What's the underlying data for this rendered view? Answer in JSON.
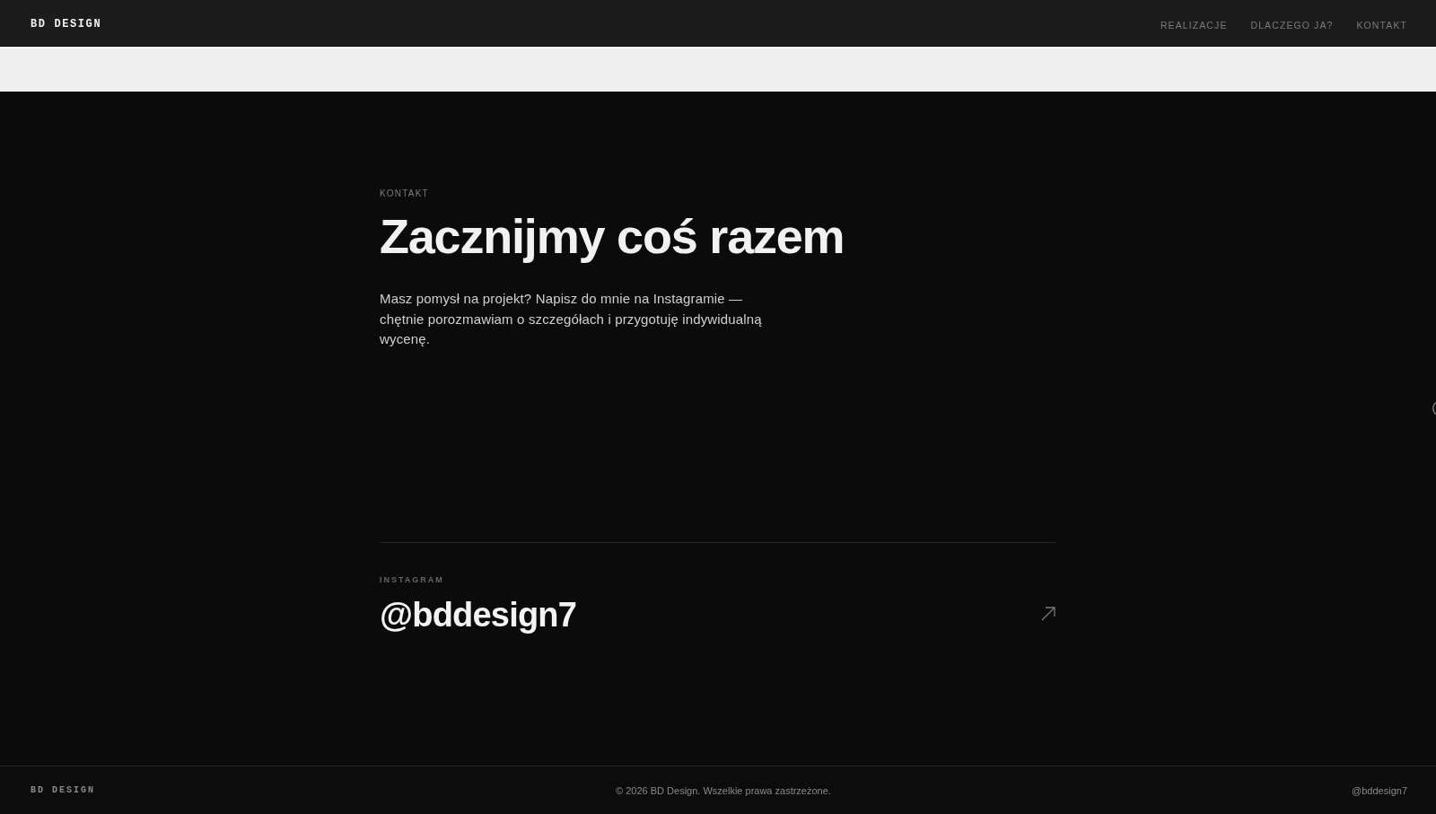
{
  "header": {
    "logo": "BD DESIGN",
    "nav": [
      "REALIZACJE",
      "DLACZEGO JA?",
      "KONTAKT"
    ]
  },
  "contact": {
    "eyebrow": "KONTAKT",
    "title": "Zacznijmy coś razem",
    "description": "Masz pomysł na projekt? Napisz do mnie na Instagramie — chętnie porozmawiam o szczegółach i przygotuję indywidualną wycenę.",
    "instagram": {
      "label": "INSTAGRAM",
      "handle": "@bddesign7"
    }
  },
  "footer": {
    "logo": "BD DESIGN",
    "copyright": "© 2026 BD Design. Wszelkie prawa zastrzeżone.",
    "handle": "@bddesign7"
  }
}
